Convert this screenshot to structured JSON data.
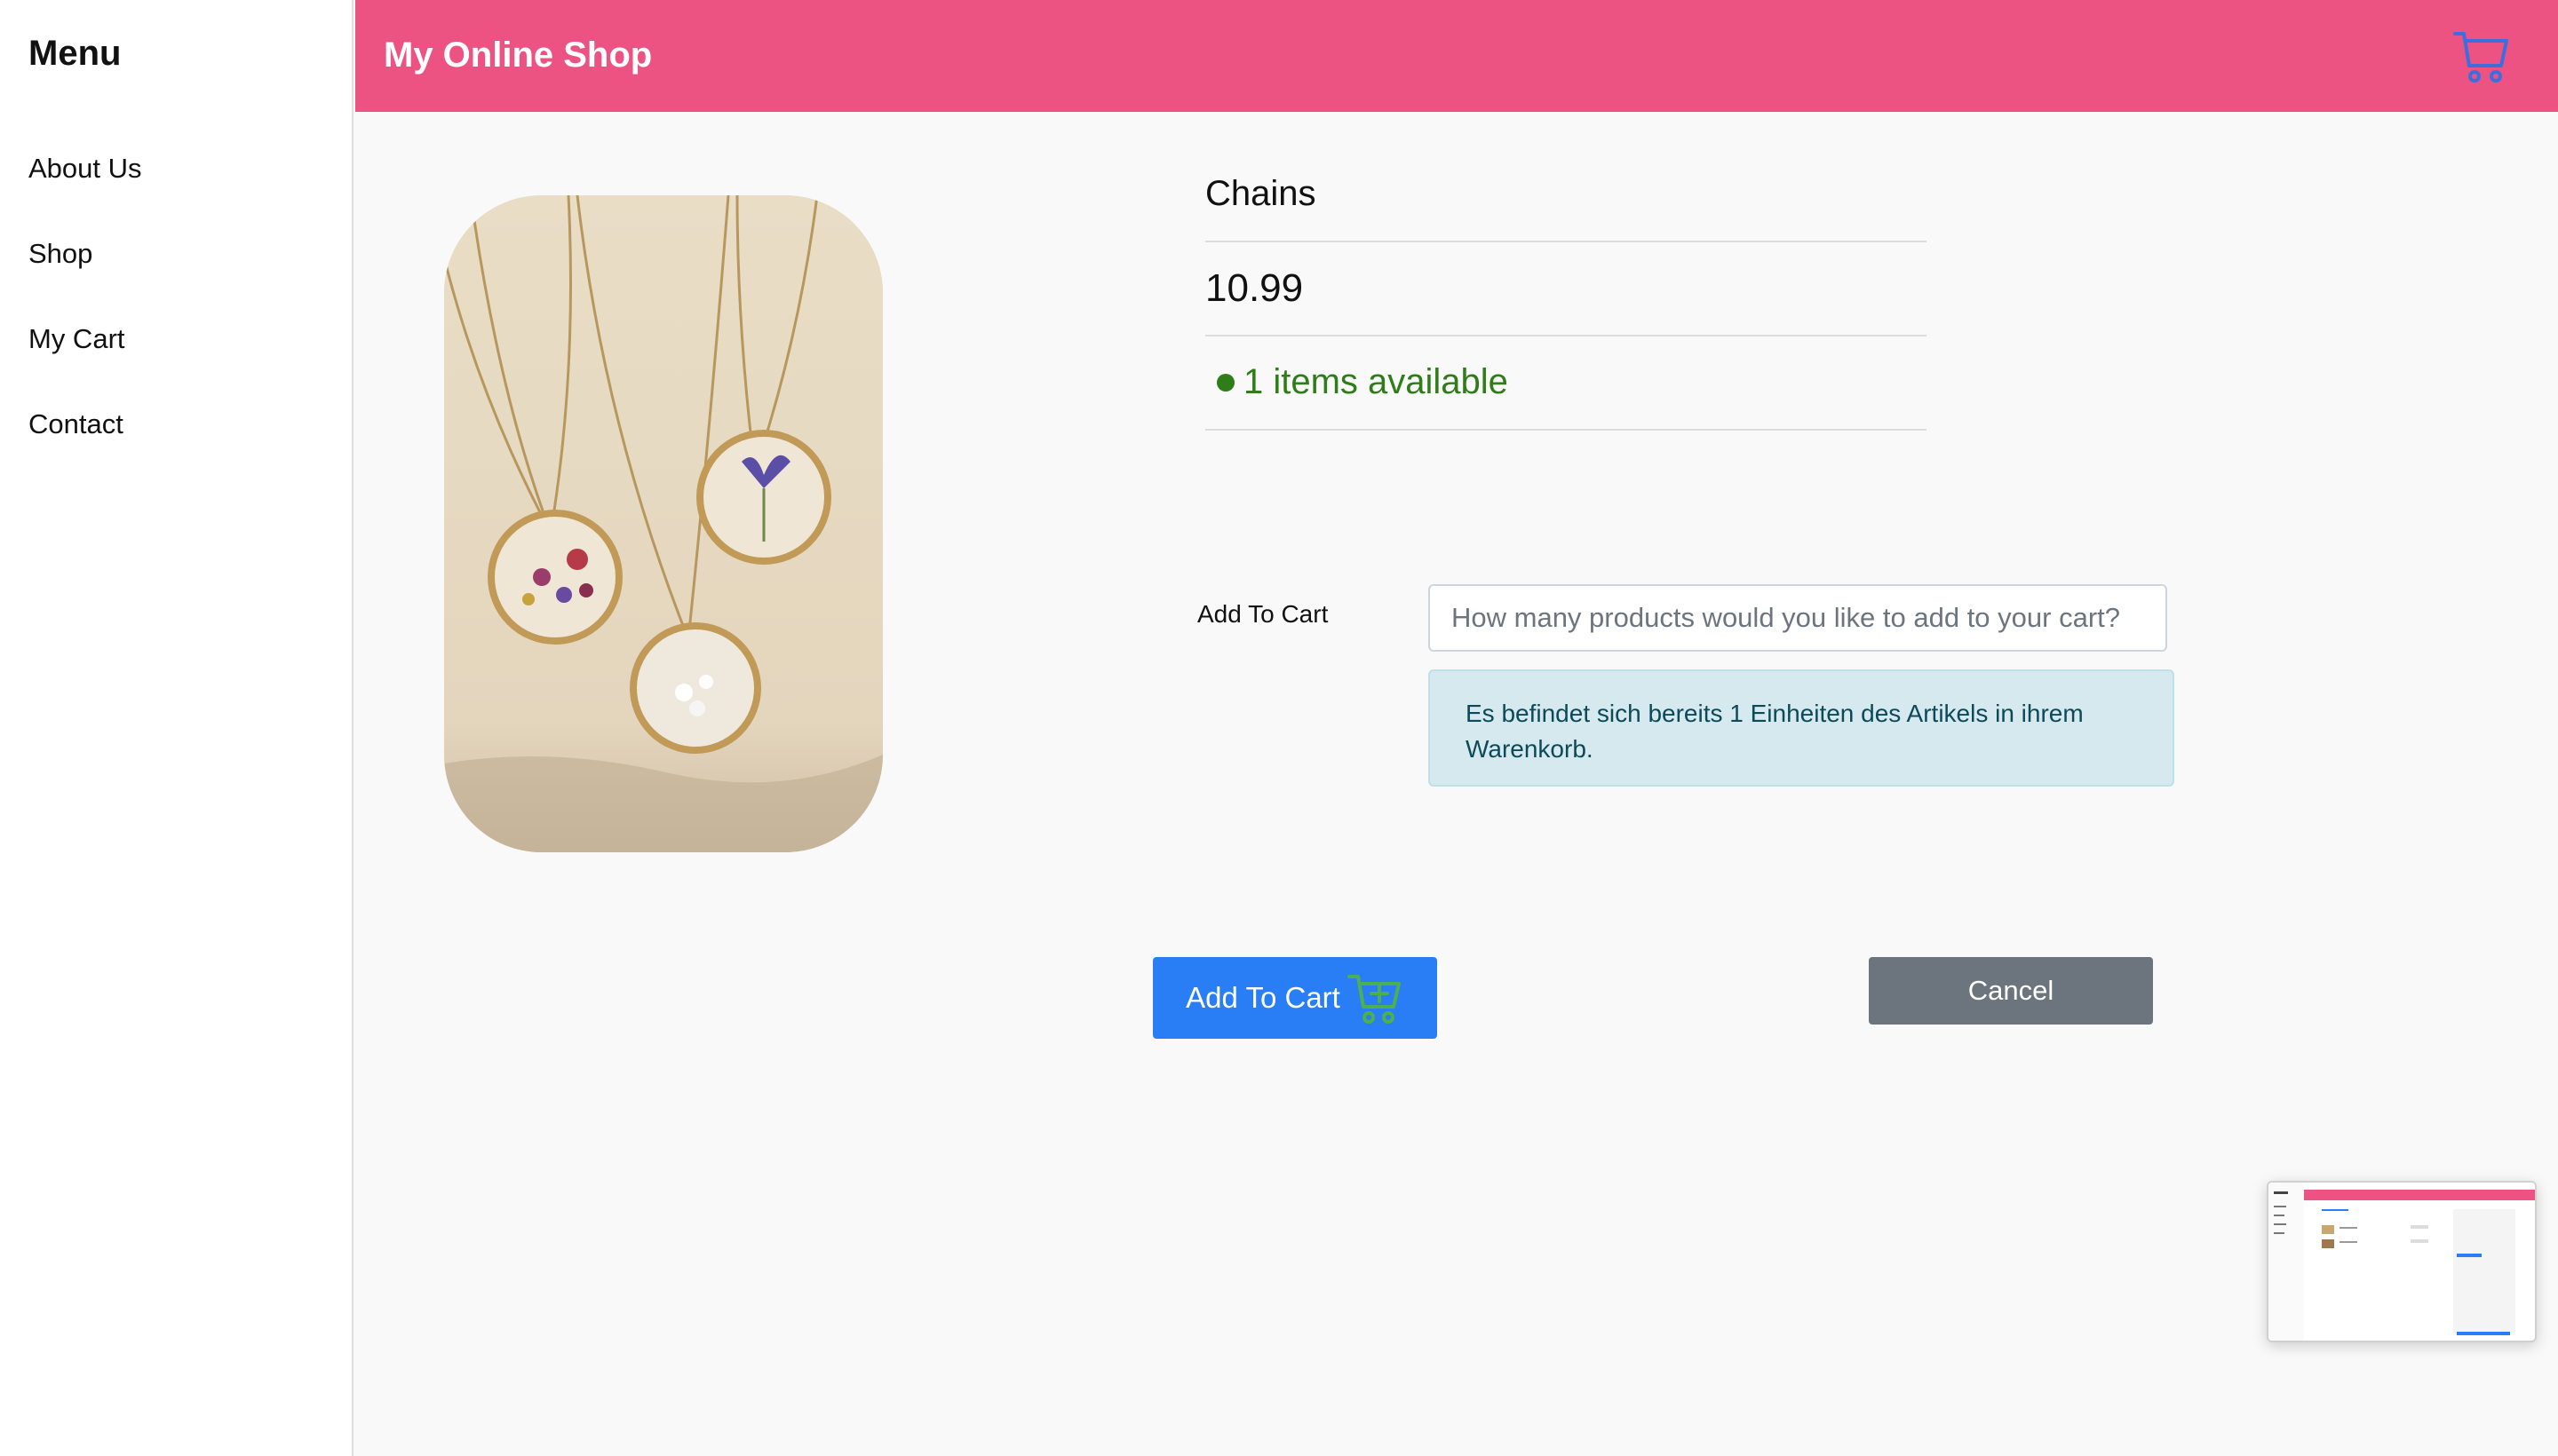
{
  "sidebar": {
    "title": "Menu",
    "items": [
      {
        "label": "About Us"
      },
      {
        "label": "Shop"
      },
      {
        "label": "My Cart"
      },
      {
        "label": "Contact"
      }
    ]
  },
  "header": {
    "title": "My Online Shop",
    "cart_icon": "cart-icon",
    "color": "#ec5282"
  },
  "product": {
    "name": "Chains",
    "price": "10.99",
    "availability": "1 items available",
    "availability_color": "#2e7d18",
    "image_icon": "necklace-photo"
  },
  "add_form": {
    "label": "Add To Cart",
    "placeholder": "How many products would you like to add to your cart?",
    "value": "",
    "info": "Es befindet sich bereits 1 Einheiten des Artikels in ihrem Warenkorb."
  },
  "buttons": {
    "add_label": "Add To Cart",
    "add_color": "#2a7ef5",
    "cancel_label": "Cancel",
    "cancel_color": "#6c757d"
  }
}
